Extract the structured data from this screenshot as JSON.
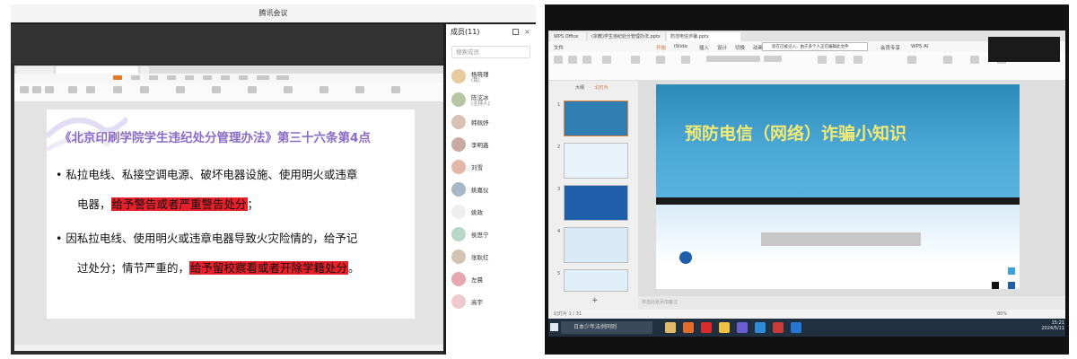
{
  "meeting": {
    "window_title": "腾讯会议",
    "members_header": "成员(11)",
    "search_placeholder": "搜索成员",
    "members": [
      {
        "name": "杨晓瑾",
        "role": "(我)"
      },
      {
        "name": "陈泫冰",
        "role": "(主持人)"
      },
      {
        "name": "韩佩妤",
        "role": ""
      },
      {
        "name": "李明鑫",
        "role": ""
      },
      {
        "name": "刘雪",
        "role": ""
      },
      {
        "name": "姚嘉仪",
        "role": ""
      },
      {
        "name": "姚政",
        "role": ""
      },
      {
        "name": "侯思宁",
        "role": ""
      },
      {
        "name": "张耿红",
        "role": ""
      },
      {
        "name": "左晨",
        "role": ""
      },
      {
        "name": "高宇",
        "role": ""
      }
    ]
  },
  "left_slide": {
    "title": "《北京印刷学院学生违纪处分管理办法》第三十六条第4点",
    "line1": "• 私拉电线、私接空调电源、破坏电器设施、使用明火或违章",
    "line2_a": "电器，",
    "line2_hl": "给予警告或者严重警告处分",
    "line2_b": "；",
    "line3": "• 因私拉电线、使用明火或违章电器导致火灾险情的，给予记",
    "line4_a": "过处分；情节严重的，",
    "line4_hl": "给予留校察看或者开除学籍处分",
    "line4_b": "。"
  },
  "right_window": {
    "tabs": [
      "WPS Office",
      "(宗教)学生违纪处分管理办法.pptx",
      "防范电信诈骗.pptx"
    ],
    "menu": [
      "文件",
      "开始",
      "iSlide",
      "插入",
      "设计",
      "切换",
      "动画",
      "放映",
      "审阅",
      "视图",
      "工具",
      "会员专享",
      "WPS AI"
    ],
    "slide_title": "预防电信（网络）诈骗小知识",
    "notes_placeholder": "单击此处添加备注",
    "status_left": "幻灯片 1 / 31",
    "zoom": "80%",
    "taskbar_search": "日本少年法例同则",
    "clock_time": "15:21",
    "clock_date": "2024/5/11",
    "notice": "您在已被记入，由于多个人正在编辑此文件"
  },
  "colors": {
    "left_title": "#8a6cc8",
    "highlight": "#e8202a",
    "right_title": "#f2ea74",
    "right_slide_top": "#2d89b9"
  }
}
